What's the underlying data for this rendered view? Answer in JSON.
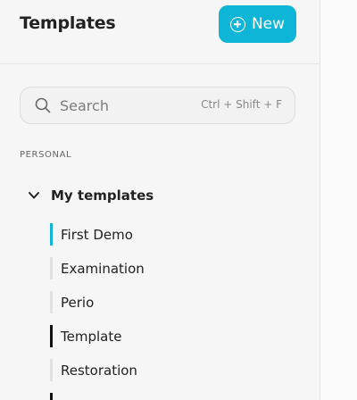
{
  "header": {
    "title": "Templates",
    "new_label": "New"
  },
  "search": {
    "placeholder": "Search",
    "shortcut": "Ctrl + Shift + F"
  },
  "sections": [
    {
      "label": "PERSONAL",
      "folder": {
        "name": "My templates",
        "expanded": true,
        "items": [
          {
            "label": "First Demo",
            "indicator": "accent"
          },
          {
            "label": "Examination",
            "indicator": "normal"
          },
          {
            "label": "Perio",
            "indicator": "normal"
          },
          {
            "label": "Template",
            "indicator": "dark"
          },
          {
            "label": "Restoration",
            "indicator": "normal"
          }
        ]
      }
    }
  ],
  "colors": {
    "accent": "#0fb5d6",
    "dark_indicator": "#111111",
    "normal_indicator": "#e1e1e1"
  },
  "icons": {
    "new": "plus-circle-icon",
    "search": "search-icon",
    "folder": "chevron-down-icon"
  }
}
